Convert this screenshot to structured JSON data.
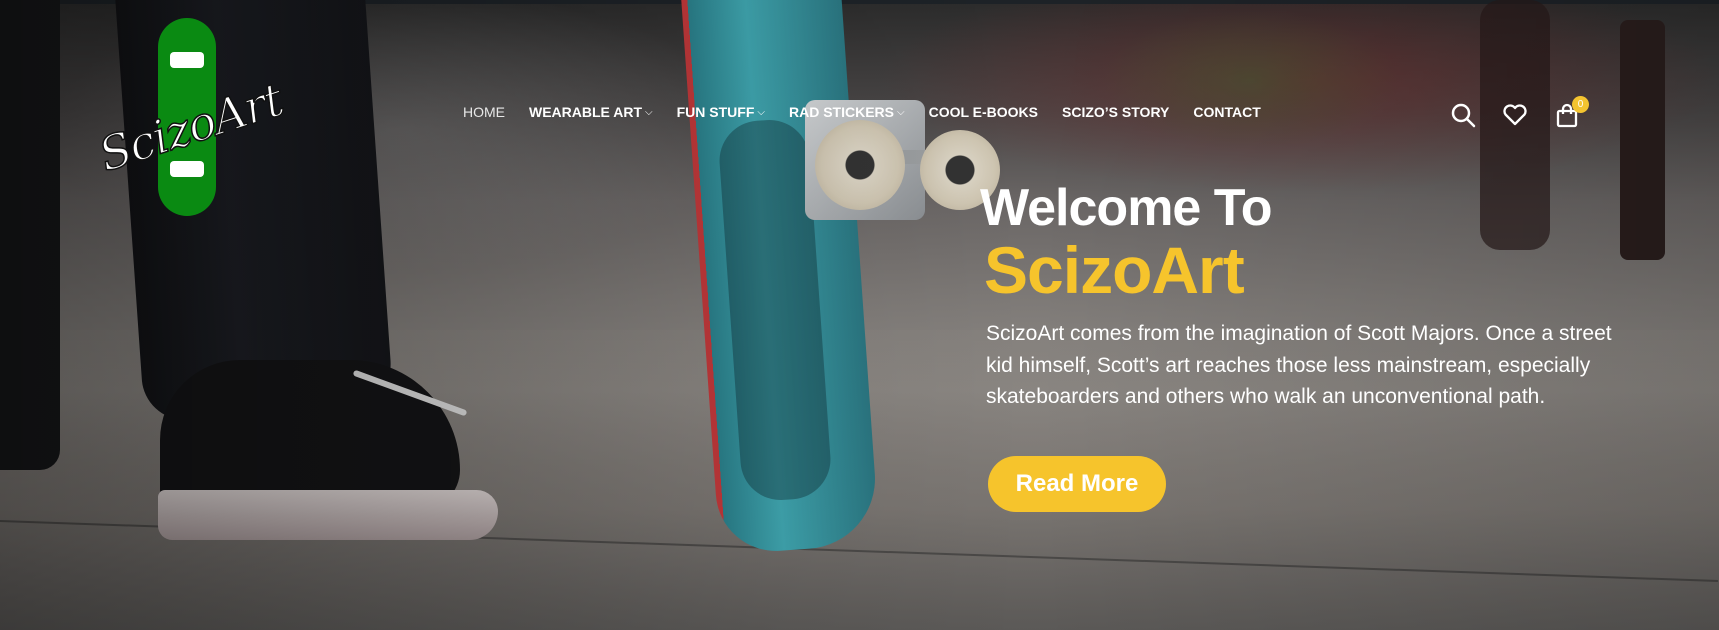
{
  "logo": {
    "text": "ScizoArt",
    "deck_color": "#0a8a12"
  },
  "nav": {
    "items": [
      {
        "label": "HOME",
        "has_dropdown": false
      },
      {
        "label": "WEARABLE ART",
        "has_dropdown": true
      },
      {
        "label": "FUN STUFF",
        "has_dropdown": true
      },
      {
        "label": "RAD STICKERS",
        "has_dropdown": true
      },
      {
        "label": "COOL E-BOOKS",
        "has_dropdown": false
      },
      {
        "label": "SCIZO’S STORY",
        "has_dropdown": false
      },
      {
        "label": "CONTACT",
        "has_dropdown": false
      }
    ],
    "dropdown_glyph": "⌵"
  },
  "header_icons": {
    "search": "search-icon",
    "wishlist": "heart-icon",
    "cart": "shopping-bag-icon",
    "cart_count": "0"
  },
  "hero": {
    "welcome": "Welcome To",
    "brand": "ScizoArt",
    "description": "ScizoArt comes from the imagination of Scott Majors. Once a street kid himself, Scott’s art reaches those less mainstream, especially skateboarders and others who walk an unconventional path.",
    "button_label": "Read More"
  },
  "colors": {
    "accent": "#f6c42c",
    "text": "#ffffff"
  }
}
